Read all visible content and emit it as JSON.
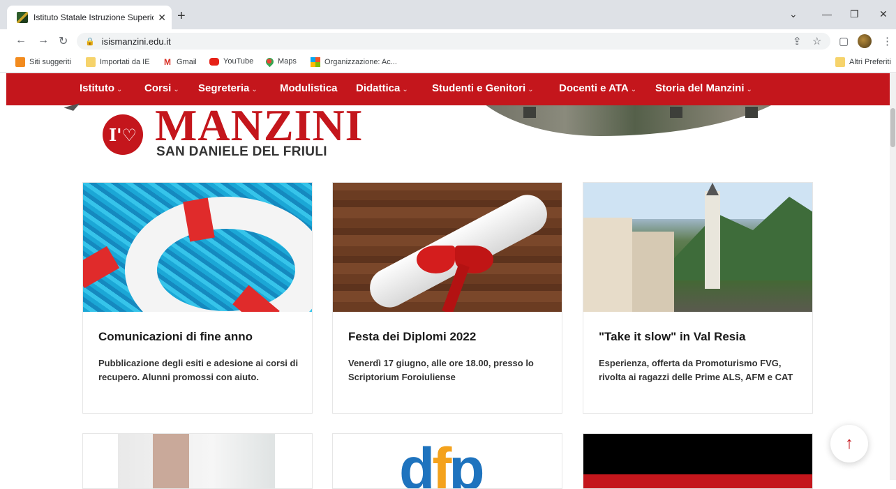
{
  "browser": {
    "tab_title": "Istituto Statale Istruzione Superio",
    "url": "isismanzini.edu.it",
    "bookmarks": [
      {
        "label": "Siti suggeriti"
      },
      {
        "label": "Importati da IE"
      },
      {
        "label": "Gmail"
      },
      {
        "label": "YouTube"
      },
      {
        "label": "Maps"
      },
      {
        "label": "Organizzazione: Ac..."
      }
    ],
    "other_bookmarks": "Altri Preferiti"
  },
  "site": {
    "brand_color": "#c4161c",
    "nav": [
      {
        "label": "Istituto",
        "dropdown": true
      },
      {
        "label": "Corsi",
        "dropdown": true
      },
      {
        "label": "Segreteria",
        "dropdown": true
      },
      {
        "label": "Modulistica",
        "dropdown": false
      },
      {
        "label": "Didattica",
        "dropdown": true
      },
      {
        "label": "Studenti e Genitori",
        "dropdown": true
      },
      {
        "label": "Docenti e ATA",
        "dropdown": true
      },
      {
        "label": "Storia del Manzini",
        "dropdown": true
      }
    ],
    "logo": {
      "mark": "I'♡",
      "word": "MANZINI",
      "sub": "SAN DANIELE DEL FRIULI"
    },
    "cards": [
      {
        "title": "Comunicazioni di fine anno",
        "desc": "Pubblicazione degli esiti e adesione ai corsi di recupero. Alunni promossi con aiuto."
      },
      {
        "title": "Festa dei Diplomi 2022",
        "desc": "Venerdì 17 giugno, alle ore 18.00, presso lo Scriptorium Foroiuliense"
      },
      {
        "title": "\"Take it slow\" in Val Resia",
        "desc": "Esperienza, offerta da Promoturismo FVG, rivolta ai ragazzi delle Prime ALS, AFM e CAT"
      }
    ],
    "dfp_logo": {
      "d": "d",
      "f": "f",
      "p": "p"
    },
    "scroll_top_icon": "arrow-up-icon"
  }
}
